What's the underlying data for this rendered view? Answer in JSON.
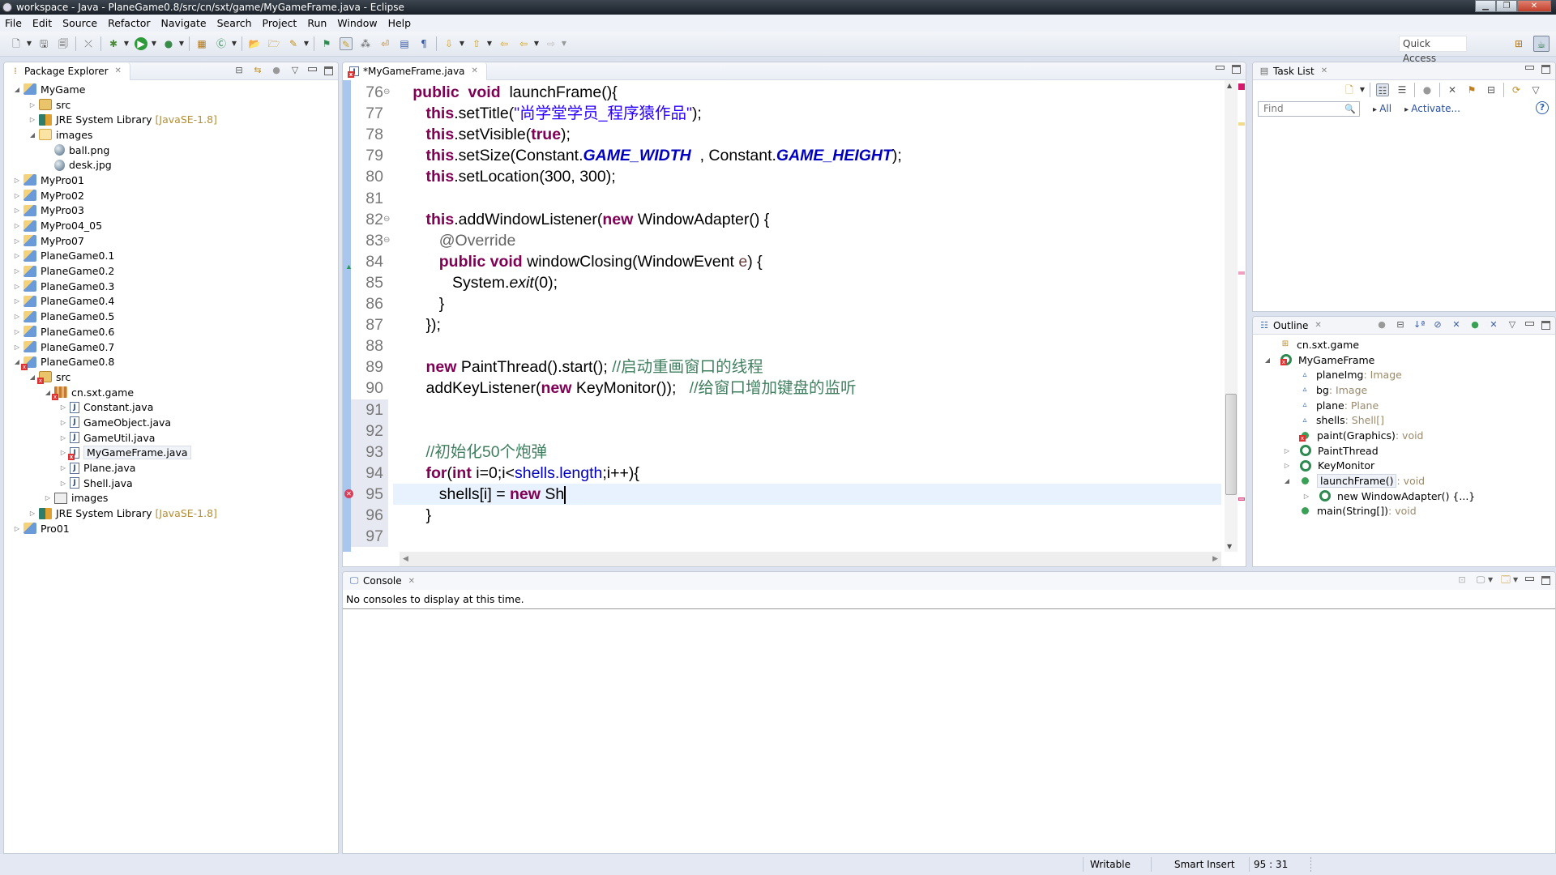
{
  "window": {
    "title": "workspace - Java - PlaneGame0.8/src/cn/sxt/game/MyGameFrame.java - Eclipse",
    "controls": [
      "minimize",
      "restore",
      "close"
    ]
  },
  "menu": [
    "File",
    "Edit",
    "Source",
    "Refactor",
    "Navigate",
    "Search",
    "Project",
    "Run",
    "Window",
    "Help"
  ],
  "toolbar": {
    "quick_access": "Quick Access"
  },
  "package_explorer": {
    "title": "Package Explorer",
    "tree": [
      {
        "label": "MyGame",
        "level": 0,
        "expanded": true,
        "icon": "project-icon"
      },
      {
        "label": "src",
        "level": 1,
        "expanded": false,
        "icon": "source-folder-icon"
      },
      {
        "label": "JRE System Library",
        "suffix": "[JavaSE-1.8]",
        "level": 1,
        "expanded": false,
        "icon": "library-icon"
      },
      {
        "label": "images",
        "level": 1,
        "expanded": true,
        "icon": "folder-icon"
      },
      {
        "label": "ball.png",
        "level": 2,
        "icon": "image-file-icon"
      },
      {
        "label": "desk.jpg",
        "level": 2,
        "icon": "image-file-icon"
      },
      {
        "label": "MyPro01",
        "level": 0,
        "expanded": false,
        "icon": "project-icon"
      },
      {
        "label": "MyPro02",
        "level": 0,
        "expanded": false,
        "icon": "project-icon"
      },
      {
        "label": "MyPro03",
        "level": 0,
        "expanded": false,
        "icon": "project-icon"
      },
      {
        "label": "MyPro04_05",
        "level": 0,
        "expanded": false,
        "icon": "project-icon"
      },
      {
        "label": "MyPro07",
        "level": 0,
        "expanded": false,
        "icon": "project-icon"
      },
      {
        "label": "PlaneGame0.1",
        "level": 0,
        "expanded": false,
        "icon": "project-icon"
      },
      {
        "label": "PlaneGame0.2",
        "level": 0,
        "expanded": false,
        "icon": "project-icon"
      },
      {
        "label": "PlaneGame0.3",
        "level": 0,
        "expanded": false,
        "icon": "project-icon"
      },
      {
        "label": "PlaneGame0.4",
        "level": 0,
        "expanded": false,
        "icon": "project-icon"
      },
      {
        "label": "PlaneGame0.5",
        "level": 0,
        "expanded": false,
        "icon": "project-icon"
      },
      {
        "label": "PlaneGame0.6",
        "level": 0,
        "expanded": false,
        "icon": "project-icon"
      },
      {
        "label": "PlaneGame0.7",
        "level": 0,
        "expanded": false,
        "icon": "project-icon"
      },
      {
        "label": "PlaneGame0.8",
        "level": 0,
        "expanded": true,
        "icon": "project-icon",
        "error": true
      },
      {
        "label": "src",
        "level": 1,
        "expanded": true,
        "icon": "source-folder-icon",
        "error": true
      },
      {
        "label": "cn.sxt.game",
        "level": 2,
        "expanded": true,
        "icon": "package-icon",
        "error": true
      },
      {
        "label": "Constant.java",
        "level": 3,
        "expanded": false,
        "icon": "java-file-icon"
      },
      {
        "label": "GameObject.java",
        "level": 3,
        "expanded": false,
        "icon": "java-file-icon"
      },
      {
        "label": "GameUtil.java",
        "level": 3,
        "expanded": false,
        "icon": "java-file-icon"
      },
      {
        "label": "MyGameFrame.java",
        "level": 3,
        "expanded": false,
        "icon": "java-file-icon",
        "error": true,
        "selected": true
      },
      {
        "label": "Plane.java",
        "level": 3,
        "expanded": false,
        "icon": "java-file-icon"
      },
      {
        "label": "Shell.java",
        "level": 3,
        "expanded": false,
        "icon": "java-file-icon"
      },
      {
        "label": "images",
        "level": 2,
        "expanded": false,
        "icon": "image-package-icon"
      },
      {
        "label": "JRE System Library",
        "suffix": "[JavaSE-1.8]",
        "level": 1,
        "expanded": false,
        "icon": "library-icon"
      },
      {
        "label": "Pro01",
        "level": 0,
        "expanded": false,
        "icon": "project-icon"
      }
    ]
  },
  "editor": {
    "tab_label": "*MyGameFrame.java",
    "lines": [
      {
        "n": "76",
        "fold": true,
        "tokens": [
          [
            "",
            "   "
          ],
          [
            "kw",
            "public"
          ],
          [
            "",
            "  "
          ],
          [
            "kw",
            "void"
          ],
          [
            "",
            "  launchFrame(){"
          ]
        ]
      },
      {
        "n": "77",
        "tokens": [
          [
            "",
            "      "
          ],
          [
            "kw",
            "this"
          ],
          [
            "",
            ".setTitle("
          ],
          [
            "str",
            "\"尚学堂学员_程序猿作品\""
          ],
          [
            "",
            ");"
          ]
        ]
      },
      {
        "n": "78",
        "tokens": [
          [
            "",
            "      "
          ],
          [
            "kw",
            "this"
          ],
          [
            "",
            ".setVisible("
          ],
          [
            "kw",
            "true"
          ],
          [
            "",
            ");"
          ]
        ]
      },
      {
        "n": "79",
        "tokens": [
          [
            "",
            "      "
          ],
          [
            "kw",
            "this"
          ],
          [
            "",
            ".setSize(Constant."
          ],
          [
            "cnst",
            "GAME_WIDTH"
          ],
          [
            "",
            "  , Constant."
          ],
          [
            "cnst",
            "GAME_HEIGHT"
          ],
          [
            "",
            ");"
          ]
        ]
      },
      {
        "n": "80",
        "tokens": [
          [
            "",
            "      "
          ],
          [
            "kw",
            "this"
          ],
          [
            "",
            ".setLocation(300, 300);"
          ]
        ]
      },
      {
        "n": "81",
        "tokens": []
      },
      {
        "n": "82",
        "fold": true,
        "tokens": [
          [
            "",
            "      "
          ],
          [
            "kw",
            "this"
          ],
          [
            "",
            ".addWindowListener("
          ],
          [
            "kw",
            "new"
          ],
          [
            "",
            " WindowAdapter() {"
          ]
        ]
      },
      {
        "n": "83",
        "fold": true,
        "tokens": [
          [
            "",
            "         "
          ],
          [
            "ann",
            "@Override"
          ]
        ]
      },
      {
        "n": "84",
        "marker": "override",
        "tokens": [
          [
            "",
            "         "
          ],
          [
            "kw",
            "public"
          ],
          [
            "",
            " "
          ],
          [
            "kw",
            "void"
          ],
          [
            "",
            " windowClosing(WindowEvent "
          ],
          [
            "param",
            "e"
          ],
          [
            "",
            ") {"
          ]
        ]
      },
      {
        "n": "85",
        "tokens": [
          [
            "",
            "            System."
          ],
          [
            "it",
            "exit"
          ],
          [
            "",
            "(0);"
          ]
        ]
      },
      {
        "n": "86",
        "tokens": [
          [
            "",
            "         }"
          ]
        ]
      },
      {
        "n": "87",
        "tokens": [
          [
            "",
            "      });"
          ]
        ]
      },
      {
        "n": "88",
        "tokens": []
      },
      {
        "n": "89",
        "tokens": [
          [
            "",
            "      "
          ],
          [
            "kw",
            "new"
          ],
          [
            "",
            " PaintThread().start(); "
          ],
          [
            "cm",
            "//启动重画窗口的线程"
          ]
        ]
      },
      {
        "n": "90",
        "tokens": [
          [
            "",
            "      addKeyListener("
          ],
          [
            "kw",
            "new"
          ],
          [
            "",
            " KeyMonitor());   "
          ],
          [
            "cm",
            "//给窗口增加键盘的监听"
          ]
        ]
      },
      {
        "n": "91",
        "q": true,
        "tokens": []
      },
      {
        "n": "92",
        "q": true,
        "tokens": []
      },
      {
        "n": "93",
        "q": true,
        "tokens": [
          [
            "",
            "      "
          ],
          [
            "cm",
            "//初始化50个炮弹"
          ]
        ]
      },
      {
        "n": "94",
        "q": true,
        "tokens": [
          [
            "",
            "      "
          ],
          [
            "kw",
            "for"
          ],
          [
            "",
            "("
          ],
          [
            "kw",
            "int"
          ],
          [
            "",
            " i=0;i<"
          ],
          [
            "fld",
            "shells"
          ],
          [
            "fld",
            ".length"
          ],
          [
            "",
            ";i++){"
          ]
        ]
      },
      {
        "n": "95",
        "q": true,
        "marker": "error",
        "current": true,
        "tokens": [
          [
            "",
            "         shells[i] = "
          ],
          [
            "kw",
            "new"
          ],
          [
            "",
            " Sh"
          ]
        ]
      },
      {
        "n": "96",
        "q": true,
        "tokens": [
          [
            "",
            "      }"
          ]
        ]
      },
      {
        "n": "97",
        "q": true,
        "tokens": []
      }
    ]
  },
  "task_list": {
    "title": "Task List",
    "find_placeholder": "Find",
    "all_link": "All",
    "activate_link": "Activate..."
  },
  "outline": {
    "title": "Outline",
    "items": [
      {
        "label": "cn.sxt.game",
        "type": "",
        "level": 0,
        "icon": "package-icon"
      },
      {
        "label": "MyGameFrame",
        "type": "",
        "level": 0,
        "icon": "class-icon",
        "expanded": true,
        "error": true
      },
      {
        "label": "planeImg",
        "type": " : Image",
        "level": 1,
        "icon": "field-icon"
      },
      {
        "label": "bg",
        "type": " : Image",
        "level": 1,
        "icon": "field-icon"
      },
      {
        "label": "plane",
        "type": " : Plane",
        "level": 1,
        "icon": "field-icon"
      },
      {
        "label": "shells",
        "type": " : Shell[]",
        "level": 1,
        "icon": "field-icon"
      },
      {
        "label": "paint(Graphics)",
        "type": " : void",
        "level": 1,
        "icon": "method-icon",
        "error": true
      },
      {
        "label": "PaintThread",
        "type": "",
        "level": 1,
        "icon": "inner-class-icon",
        "expanded": false
      },
      {
        "label": "KeyMonitor",
        "type": "",
        "level": 1,
        "icon": "inner-class-icon",
        "expanded": false
      },
      {
        "label": "launchFrame()",
        "type": " : void",
        "level": 1,
        "icon": "method-icon",
        "expanded": true,
        "selected": true
      },
      {
        "label": "new WindowAdapter() {...}",
        "type": "",
        "level": 2,
        "icon": "inner-class-icon",
        "expanded": false
      },
      {
        "label": "main(String[])",
        "type": " : void",
        "level": 1,
        "icon": "static-method-icon"
      }
    ]
  },
  "console": {
    "title": "Console",
    "message": "No consoles to display at this time."
  },
  "status": {
    "writable": "Writable",
    "insert_mode": "Smart Insert",
    "position": "95 : 31"
  }
}
